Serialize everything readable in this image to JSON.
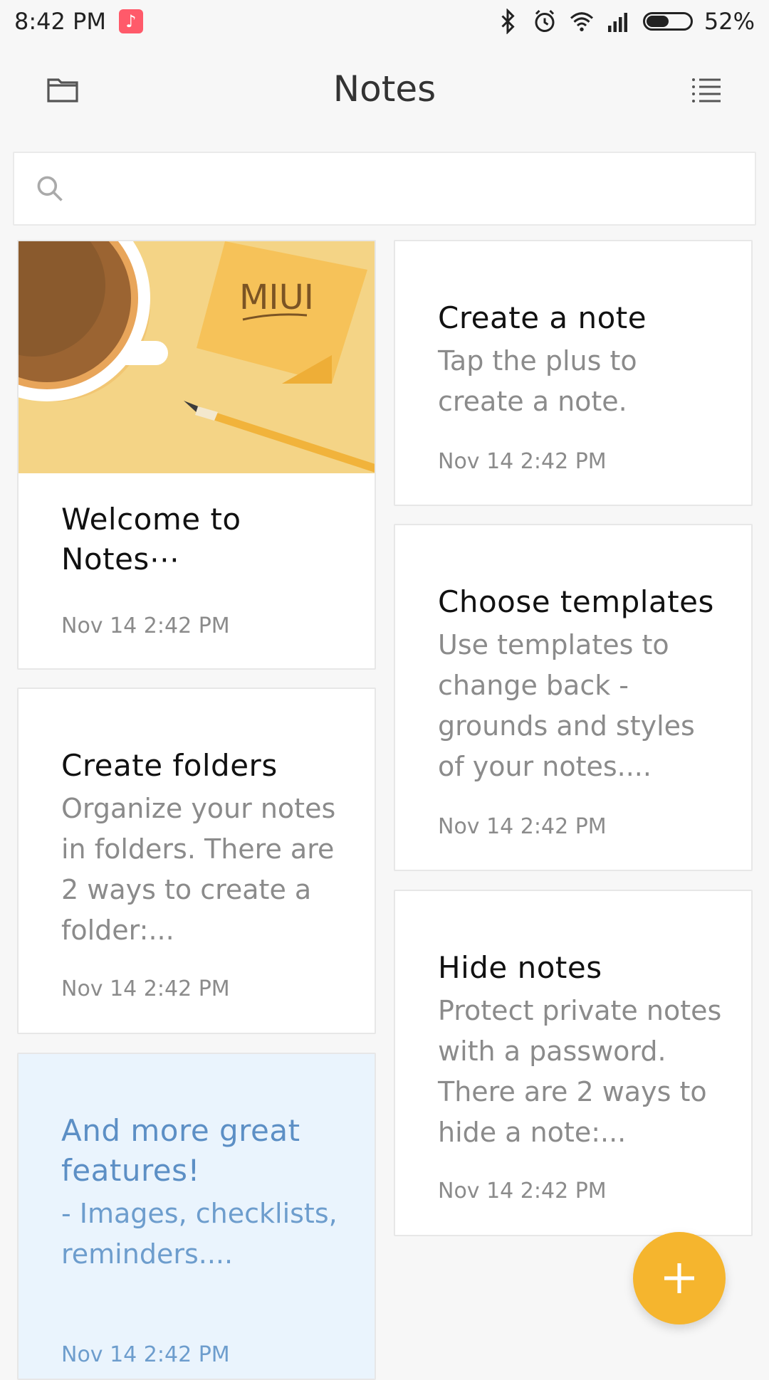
{
  "status_bar": {
    "time": "8:42 PM",
    "battery": "52%",
    "battery_level_percent": 52,
    "icons": [
      "music-app-icon",
      "bluetooth-icon",
      "alarm-icon",
      "wifi-icon",
      "signal-icon",
      "battery-icon"
    ]
  },
  "header": {
    "title": "Notes",
    "left_icon": "folder-icon",
    "right_icon": "list-view-icon"
  },
  "search": {
    "placeholder": "",
    "icon": "search-icon"
  },
  "notes": [
    {
      "title": "Welcome to Notes⋯",
      "body": "",
      "time": "Nov 14 2:42 PM",
      "image_text": "MIUI"
    },
    {
      "title": "Create a note",
      "body": "Tap the plus to create a note.",
      "time": "Nov 14 2:42 PM"
    },
    {
      "title": "Choose templates",
      "body": "Use templates to change back - grounds and styles of your notes....",
      "time": "Nov 14 2:42 PM"
    },
    {
      "title": "Create folders",
      "body": "Organize your notes in folders. There are 2 ways to create a folder:...",
      "time": "Nov 14 2:42 PM"
    },
    {
      "title": "Hide notes",
      "body": "Protect private notes with a password. There are 2 ways to hide a note:...",
      "time": "Nov 14 2:42 PM"
    },
    {
      "title": "And more great features!",
      "body": " - Images, checklists, reminders....",
      "time": "Nov 14 2:42 PM"
    }
  ],
  "colors": {
    "accent": "#f5b52e",
    "highlight_card": "#eaf4fd",
    "highlight_text": "#5c8fc5"
  },
  "fab": {
    "icon": "plus-icon"
  }
}
